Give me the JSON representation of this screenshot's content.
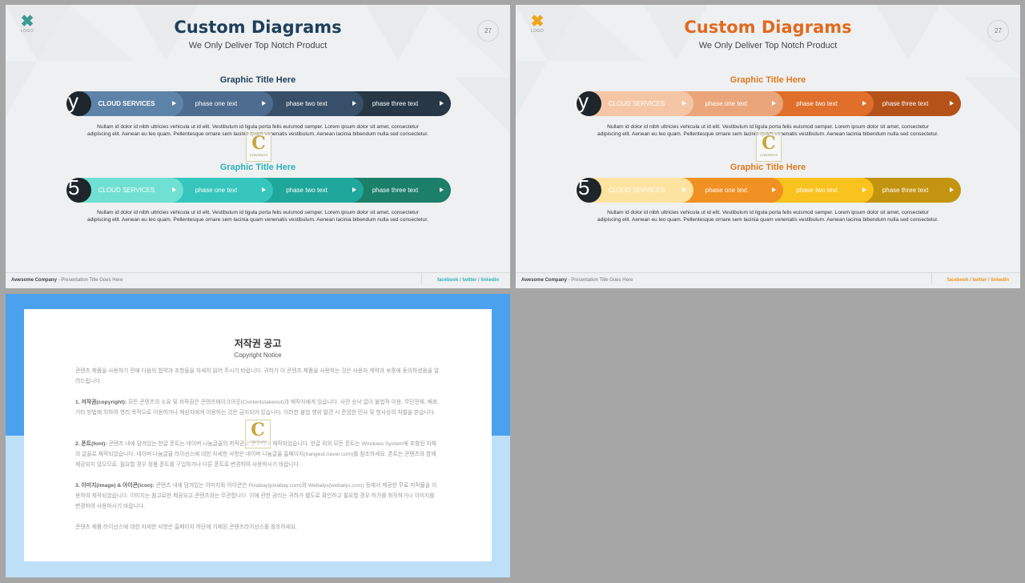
{
  "slides": [
    {
      "title": "Custom Diagrams",
      "subtitle": "We Only Deliver Top Notch Product",
      "page_number": "27",
      "logo": "LOGO",
      "title_color": "#1f3f5b",
      "logo_color": "#3a9a96",
      "footer": {
        "company": "Awesome Company",
        "presentation": "- Presentation Title Goes Here",
        "facebook": "facebook",
        "sep1": " / ",
        "twitter": "twitter",
        "sep2": " / ",
        "linkedin": "linkedin",
        "link_color": "#2fb2b8"
      },
      "diagrams": [
        {
          "graphic_title": "Graphic Title Here",
          "title_color": "#1f3f5b",
          "circle_glyph": "y",
          "segments": [
            {
              "label": "CLOUD SERVICES",
              "color": "#5d83a8"
            },
            {
              "label": "phase one text",
              "color": "#4e6c90"
            },
            {
              "label": "phase two text",
              "color": "#374f69"
            },
            {
              "label": "phase three text",
              "color": "#273746"
            }
          ],
          "text_line1": "Nullam id dolor id nibh ultricies vehicula ut id elit. Vestibulum id ligula porta felis euismod semper. Lorem ipsum dolor sit amet, consectetur",
          "text_line2": "adipiscing elit. Aenean eu leo quam. Pellentesque ornare sem lacinia quam venenatis vestibulum. Aenean lacinia bibendum nulla sed consectetur."
        },
        {
          "graphic_title": "Graphic Title Here",
          "title_color": "#2fb2b8",
          "circle_glyph": "5",
          "segments": [
            {
              "label": "CLOUD SERVICES",
              "color": "#6fe0d2"
            },
            {
              "label": "phase one text",
              "color": "#36c6bd"
            },
            {
              "label": "phase two text",
              "color": "#20a79c"
            },
            {
              "label": "phase three text",
              "color": "#1b7f69"
            }
          ],
          "text_line1": "Nullam id dolor id nibh ultricies vehicula ut id elit. Vestibulum id ligula porta felis euismod semper. Lorem ipsum dolor sit amet, consectetur",
          "text_line2": "adipiscing elit. Aenean eu leo quam. Pellentesque ornare sem lacinia quam venenatis vestibulum. Aenean lacinia bibendum nulla sed consectetur."
        }
      ]
    },
    {
      "title": "Custom Diagrams",
      "subtitle": "We Only Deliver Top Notch Product",
      "page_number": "27",
      "logo": "LOGO",
      "title_color": "#e06a1f",
      "logo_color": "#f2a51a",
      "footer": {
        "company": "Awesome Company",
        "presentation": "- Presentation Title Goes Here",
        "facebook": "facebook",
        "sep1": " / ",
        "twitter": "twitter",
        "sep2": " / ",
        "linkedin": "linkedin",
        "link_color": "#f2941a"
      },
      "diagrams": [
        {
          "graphic_title": "Graphic Title Here",
          "title_color": "#e07a1f",
          "circle_glyph": "y",
          "segments": [
            {
              "label": "CLOUD SERVICES",
              "color": "#f5c6a5"
            },
            {
              "label": "phase one text",
              "color": "#eaa57a"
            },
            {
              "label": "phase two text",
              "color": "#e06f2c"
            },
            {
              "label": "phase three text",
              "color": "#b4521a"
            }
          ],
          "text_line1": "Nullam id dolor id nibh ultricies vehicula ut id elit. Vestibulum id ligula porta felis euismod semper. Lorem ipsum dolor sit amet, consectetur",
          "text_line2": "adipiscing elit. Aenean eu leo quam. Pellentesque ornare sem lacinia quam venenatis vestibulum. Aenean lacinia bibendum nulla sed consectetur."
        },
        {
          "graphic_title": "Graphic Title Here",
          "title_color": "#e07a1f",
          "circle_glyph": "5",
          "segments": [
            {
              "label": "CLOUD SERVICES",
              "color": "#fde3a0"
            },
            {
              "label": "phase one text",
              "color": "#f19023"
            },
            {
              "label": "phase two text",
              "color": "#f9c21e"
            },
            {
              "label": "phase three text",
              "color": "#c39410"
            }
          ],
          "text_line1": "Nullam id dolor id nibh ultricies vehicula ut id elit. Vestibulum id ligula porta felis euismod semper. Lorem ipsum dolor sit amet, consectetur",
          "text_line2": "adipiscing elit. Aenean eu leo quam. Pellentesque ornare sem lacinia quam venenatis vestibulum. Aenean lacinia bibendum nulla sed consectetur."
        }
      ]
    }
  ],
  "watermark": {
    "letter": "C",
    "text": "CONTENTS"
  },
  "copyright": {
    "title": "저작권 공고",
    "subtitle": "Copyright Notice",
    "intro": "콘텐츠 제품을 사용하기 전에 다음의 협약과 조항들을 자세히 읽어 주시기 바랍니다. 귀하가 이 콘텐츠 제품을 사용하는 것은 사용자 계약과 보증에 동의하셨음을 알려드립니다.",
    "s1_head": "1. 저작권(copyright):",
    "s1_body": " 모든 콘텐츠의 소유 및 저작권은 콘텐츠테이크아웃(Contentstakeout)과 제작자에게 있습니다. 사전 승낙 없이 불법적 이용, 무단전재, 배포, 기타 방법에 의하여 영리 목적으로 이용하거나 제삼자에게 이용하는 것은 금지되어 있습니다. 이러한 불법 행위 발견 시 준엄한 민사 및 형사상의 처벌을 받습니다.",
    "s2_head": "2. 폰트(font):",
    "s2_body": " 콘텐츠 내에 담겨있는 한글 폰트는 네이버 나눔글꼴의 저작권을 준수하여 제작되었습니다. 한글 외의 모든 폰트는 Windows System에 포함된 자체의 글꼴로 제작되었습니다. 네이버 나눔글꼴 라이선스에 대한 자세한 사항은 네이버 나눔글꼴 홈페이지(hangeul.naver.com)를 참조하세요. 폰트는 콘텐츠와 함께 제공되지 않으므로, 필요할 경우 정품 폰트를 구입하거나 다른 폰트로 변경하여 사용하시기 바랍니다.",
    "s3_head": "3. 이미지(image) & 아이콘(icon):",
    "s3_body": " 콘텐츠 내에 담겨있는 이미지와 아이콘은 Pixabay(pixabay.com)와 Webalys(webalys.com) 등에서 제공한 무료 저작물을 이용하여 제작되었습니다. 이미지는 참고로만 제공되고 콘텐츠와는 무관합니다. 이에 관한 권리는 귀하가 별도로 확인하고 필요할 경우 허가를 취득하거나 이미지를 변경하여 사용하시기 바랍니다.",
    "outro": "콘텐츠 제품 라이선스에 대한 자세한 사항은 홈페이지 하단에 기재된 콘텐츠라이선스를 참조하세요."
  }
}
